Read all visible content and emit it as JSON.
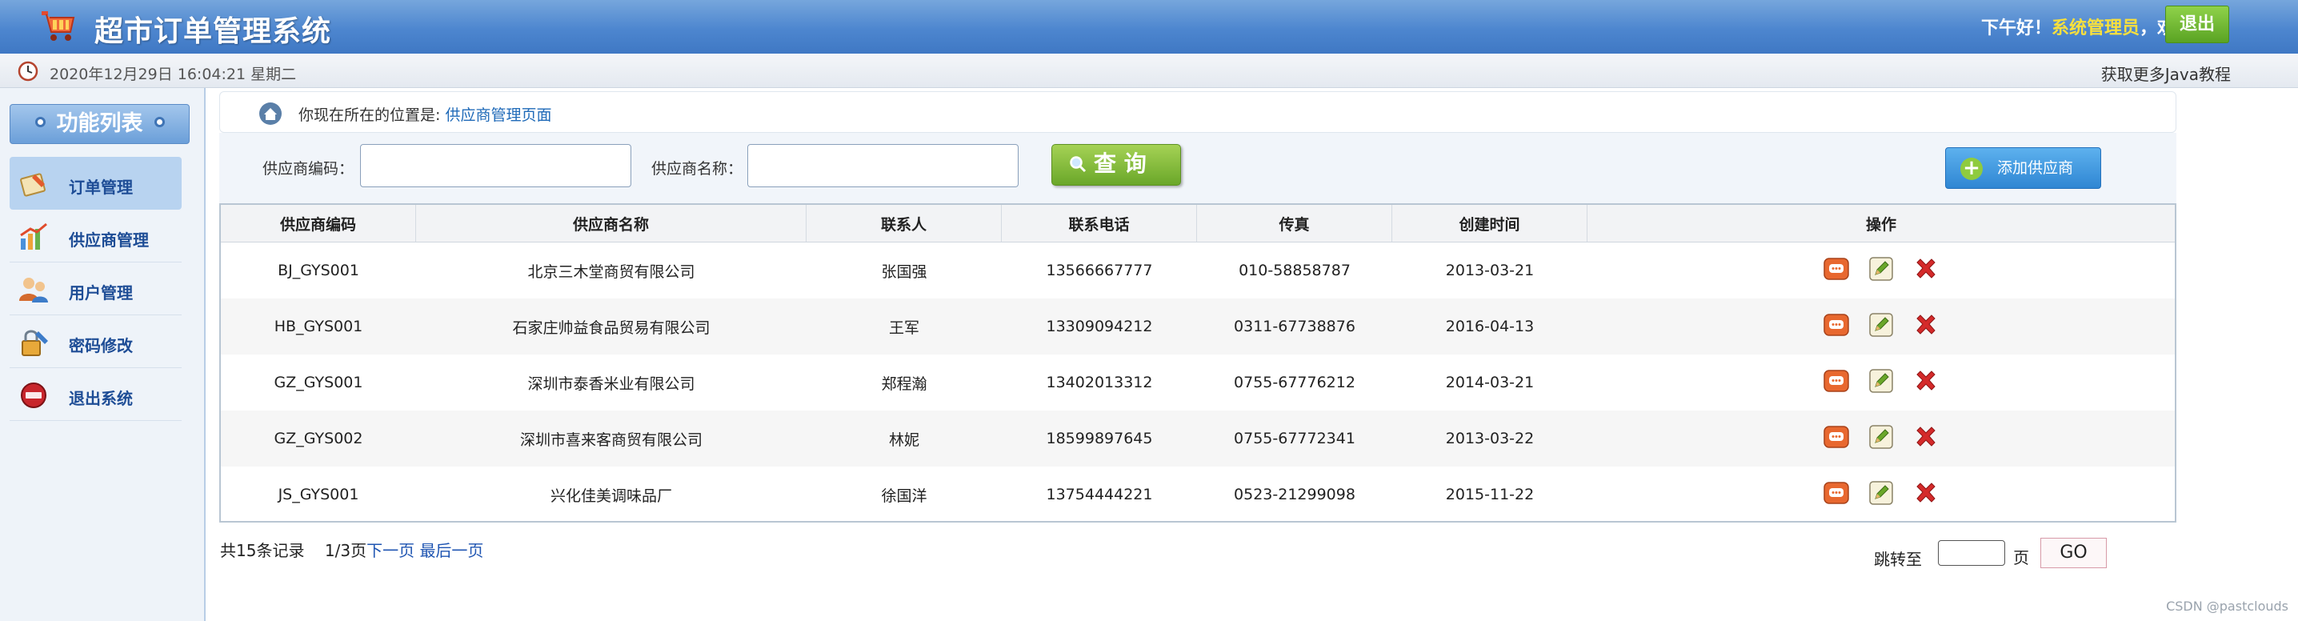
{
  "header": {
    "title": "超市订单管理系统",
    "greeting_prefix": "下午好！",
    "user_name": "系统管理员",
    "greeting_suffix": "，欢迎你！",
    "logout_label": "退出"
  },
  "infobar": {
    "datetime": "2020年12月29日 16:04:21 星期二",
    "more_link": "获取更多Java教程"
  },
  "sidebar": {
    "heading": "功能列表",
    "items": [
      {
        "label": "订单管理",
        "icon": "order-icon",
        "active": true
      },
      {
        "label": "供应商管理",
        "icon": "supplier-icon",
        "active": false
      },
      {
        "label": "用户管理",
        "icon": "user-icon",
        "active": false
      },
      {
        "label": "密码修改",
        "icon": "password-icon",
        "active": false
      },
      {
        "label": "退出系统",
        "icon": "exit-icon",
        "active": false
      }
    ]
  },
  "breadcrumb": {
    "prefix": "你现在所在的位置是:",
    "current": "供应商管理页面"
  },
  "search": {
    "code_label": "供应商编码：",
    "code_value": "",
    "name_label": "供应商名称：",
    "name_value": "",
    "query_label": "查 询",
    "add_label": "添加供应商"
  },
  "table": {
    "columns": [
      "供应商编码",
      "供应商名称",
      "联系人",
      "联系电话",
      "传真",
      "创建时间",
      "操作"
    ],
    "rows": [
      [
        "BJ_GYS001",
        "北京三木堂商贸有限公司",
        "张国强",
        "13566667777",
        "010-58858787",
        "2013-03-21"
      ],
      [
        "HB_GYS001",
        "石家庄帅益食品贸易有限公司",
        "王军",
        "13309094212",
        "0311-67738876",
        "2016-04-13"
      ],
      [
        "GZ_GYS001",
        "深圳市泰香米业有限公司",
        "郑程瀚",
        "13402013312",
        "0755-67776212",
        "2014-03-21"
      ],
      [
        "GZ_GYS002",
        "深圳市喜来客商贸有限公司",
        "林妮",
        "18599897645",
        "0755-67772341",
        "2013-03-22"
      ],
      [
        "JS_GYS001",
        "兴化佳美调味品厂",
        "徐国洋",
        "13754444221",
        "0523-21299098",
        "2015-11-22"
      ]
    ]
  },
  "pagination": {
    "total": "共15条记录",
    "pages": "1/3页",
    "next": "下一页",
    "last": "最后一页",
    "jump_label": "跳转至",
    "unit": "页",
    "go_label": "GO"
  },
  "watermark": "CSDN @pastclouds",
  "colors": {
    "header": "#4d86cf",
    "accent_yellow": "#f8e03d",
    "link": "#1f55b2",
    "green": "#6aa729"
  }
}
